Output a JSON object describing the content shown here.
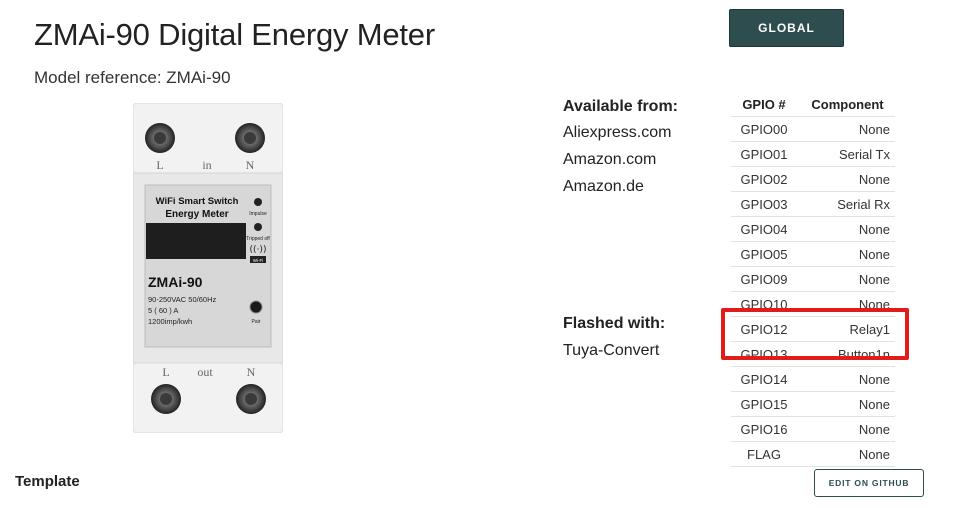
{
  "page": {
    "title": "ZMAi-90 Digital Energy Meter",
    "model_reference": "Model reference: ZMAi-90"
  },
  "header": {
    "global_button": "GLOBAL"
  },
  "device_image": {
    "label_L_top": "L",
    "label_in": "in",
    "label_N_top": "N",
    "brand_line1": "WiFi Smart Switch",
    "brand_line2": "Energy Meter",
    "impulse": "Impulse",
    "tripped": "Tripped off",
    "wifi": "Wi-Fi",
    "model": "ZMAi-90",
    "spec1": "90-250VAC  50/60Hz",
    "spec2": "5 ( 60 ) A",
    "spec3": "1200imp/kwh",
    "pair": "Pair",
    "label_L_bottom": "L",
    "label_out": "out",
    "label_N_bottom": "N"
  },
  "availability": {
    "heading": "Available from:",
    "stores": [
      "Aliexpress.com",
      "Amazon.com",
      "Amazon.de"
    ]
  },
  "flashed": {
    "heading": "Flashed with:",
    "value": "Tuya-Convert"
  },
  "gpio_table": {
    "headers": {
      "pin": "GPIO #",
      "component": "Component"
    },
    "rows": [
      {
        "pin": "GPIO00",
        "component": "None"
      },
      {
        "pin": "GPIO01",
        "component": "Serial Tx"
      },
      {
        "pin": "GPIO02",
        "component": "None"
      },
      {
        "pin": "GPIO03",
        "component": "Serial Rx"
      },
      {
        "pin": "GPIO04",
        "component": "None"
      },
      {
        "pin": "GPIO05",
        "component": "None"
      },
      {
        "pin": "GPIO09",
        "component": "None"
      },
      {
        "pin": "GPIO10",
        "component": "None"
      },
      {
        "pin": "GPIO12",
        "component": "Relay1"
      },
      {
        "pin": "GPIO13",
        "component": "Button1n"
      },
      {
        "pin": "GPIO14",
        "component": "None"
      },
      {
        "pin": "GPIO15",
        "component": "None"
      },
      {
        "pin": "GPIO16",
        "component": "None"
      },
      {
        "pin": "FLAG",
        "component": "None"
      }
    ]
  },
  "template": {
    "label": "Template",
    "edit_button": "EDIT ON GITHUB"
  },
  "colors": {
    "accent": "#2e4d4e",
    "highlight": "#e41b1b"
  }
}
